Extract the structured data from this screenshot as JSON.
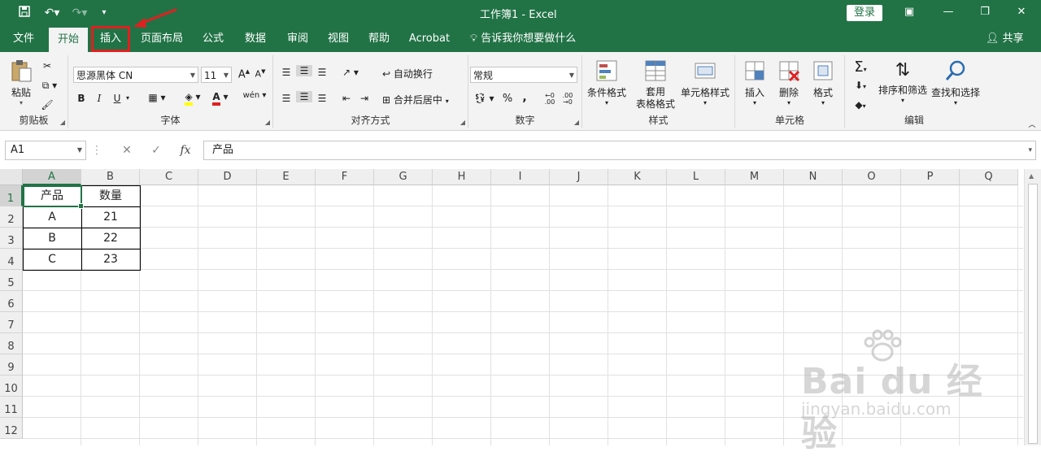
{
  "window": {
    "title": "工作簿1 - Excel",
    "login_label": "登录"
  },
  "tabs": [
    {
      "label": "文件"
    },
    {
      "label": "开始"
    },
    {
      "label": "插入"
    },
    {
      "label": "页面布局"
    },
    {
      "label": "公式"
    },
    {
      "label": "数据"
    },
    {
      "label": "审阅"
    },
    {
      "label": "视图"
    },
    {
      "label": "帮助"
    },
    {
      "label": "Acrobat"
    }
  ],
  "active_tab": "开始",
  "highlighted_tab": "插入",
  "tell_me": "告诉我你想要做什么",
  "share_label": "共享",
  "ribbon": {
    "clipboard": {
      "label": "剪贴板",
      "paste": "粘贴"
    },
    "font": {
      "label": "字体",
      "font_name": "思源黑体 CN",
      "font_size": "11",
      "bold": "B",
      "italic": "I",
      "underline": "U"
    },
    "alignment": {
      "label": "对齐方式",
      "wrap_text": "自动换行",
      "merge_center": "合并后居中"
    },
    "number": {
      "label": "数字",
      "format": "常规",
      "percent": "%",
      "comma": ","
    },
    "styles": {
      "label": "样式",
      "conditional": "条件格式",
      "table_format_1": "套用",
      "table_format_2": "表格格式",
      "cell_styles": "单元格样式"
    },
    "cells": {
      "label": "单元格",
      "insert": "插入",
      "delete": "删除",
      "format": "格式"
    },
    "editing": {
      "label": "编辑",
      "sort_filter": "排序和筛选",
      "find_select": "查找和选择"
    }
  },
  "formula_bar": {
    "name_box": "A1",
    "fx": "fx",
    "content": "产品"
  },
  "sheet": {
    "columns": [
      "A",
      "B",
      "C",
      "D",
      "E",
      "F",
      "G",
      "H",
      "I",
      "J",
      "K",
      "L",
      "M",
      "N",
      "O",
      "P",
      "Q"
    ],
    "rows": [
      "1",
      "2",
      "3",
      "4",
      "5",
      "6",
      "7",
      "8",
      "9",
      "10",
      "11",
      "12"
    ],
    "cells": [
      [
        "产品",
        "数量"
      ],
      [
        "A",
        "21"
      ],
      [
        "B",
        "22"
      ],
      [
        "C",
        "23"
      ]
    ]
  },
  "watermark": {
    "brand": "Bai du 经验",
    "url": "jingyan.baidu.com"
  },
  "colors": {
    "accent": "#217346",
    "highlight": "#e02020"
  }
}
